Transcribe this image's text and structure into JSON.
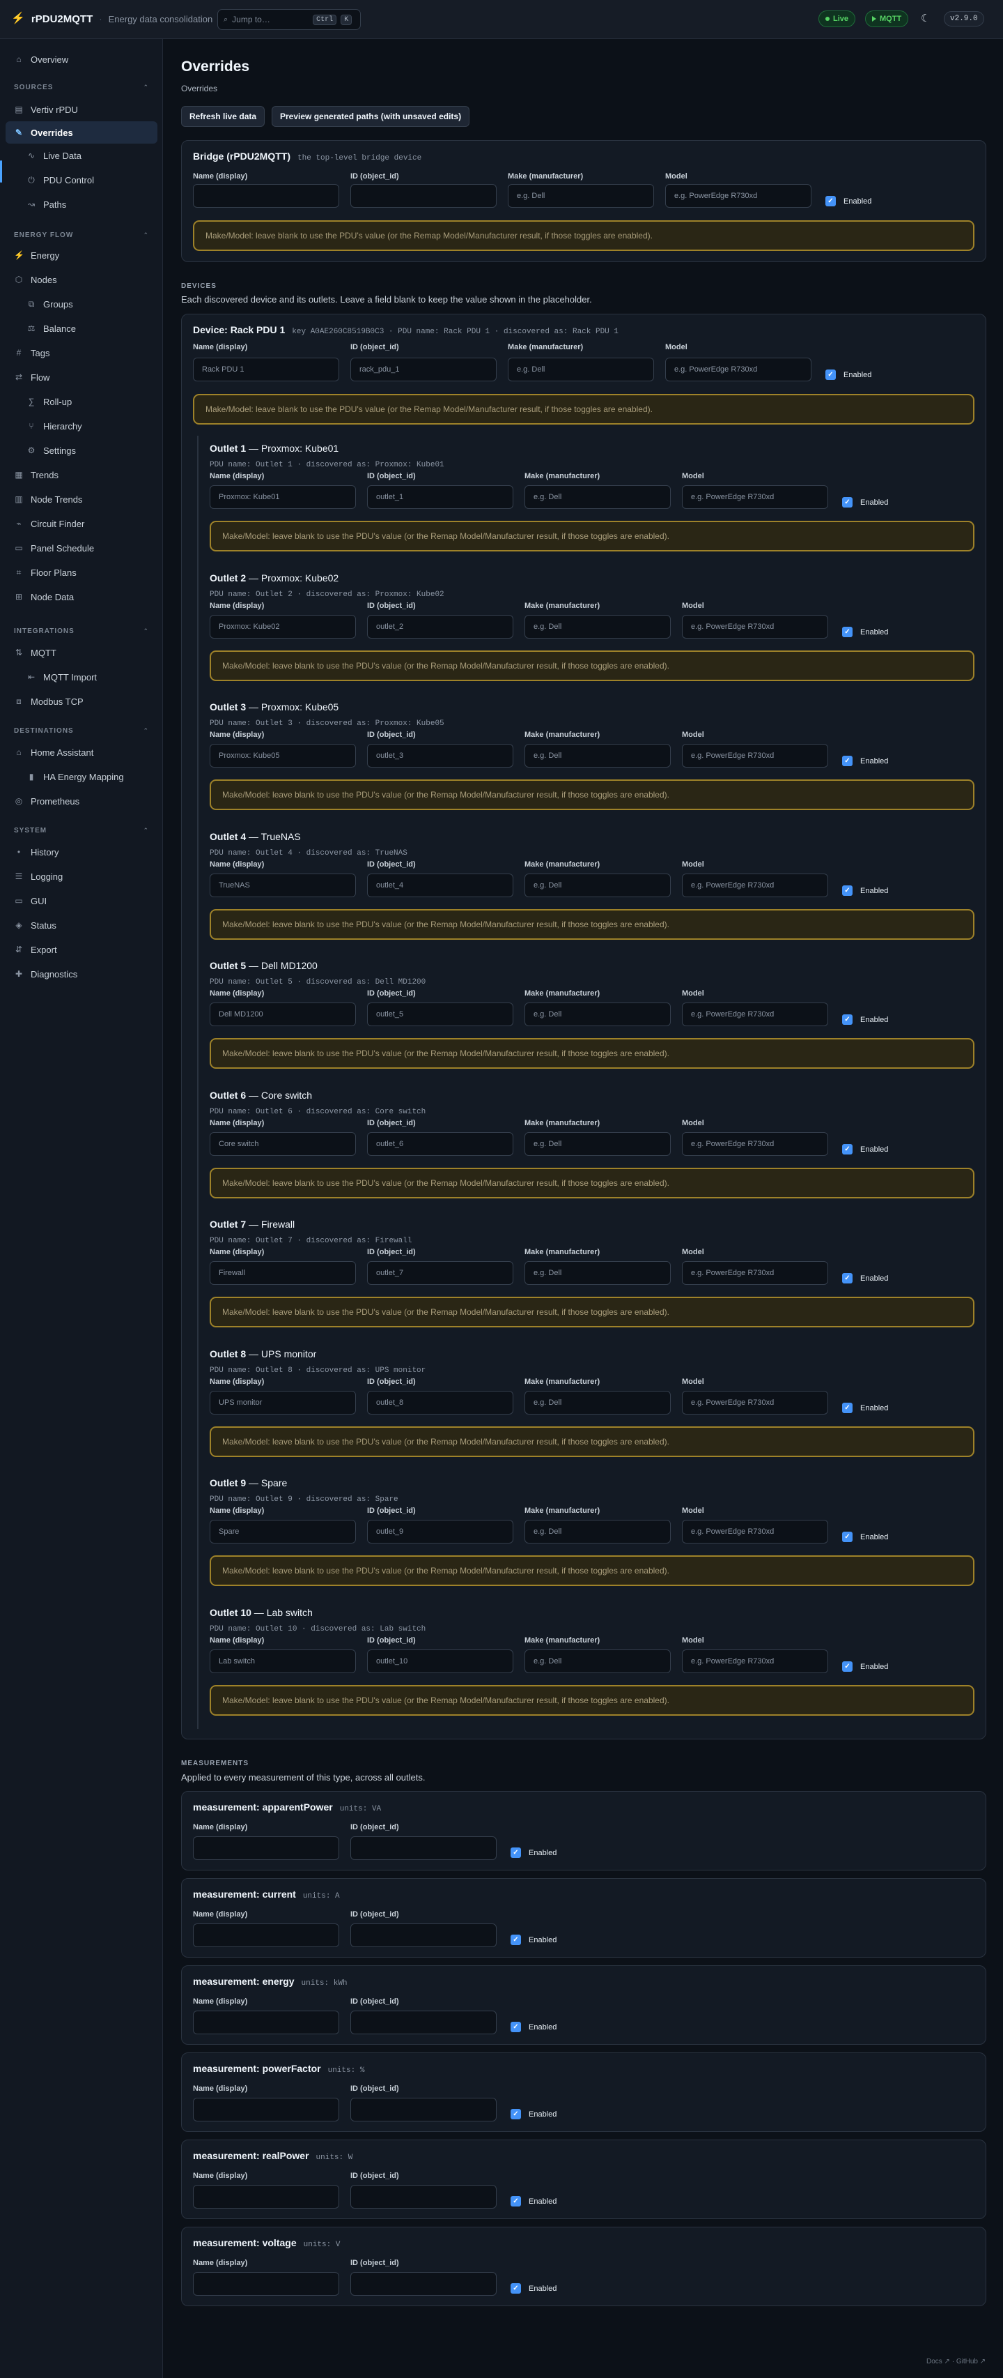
{
  "topbar": {
    "brand": "rPDU2MQTT",
    "subtitle": "Energy data consolidation",
    "search_placeholder": "Jump to…",
    "shortcut_ctrl": "Ctrl",
    "shortcut_k": "K",
    "live_badge": "Live",
    "mqtt_badge": "MQTT",
    "version": "v2.9.0"
  },
  "sidebar": {
    "overview": "Overview",
    "sections": {
      "sources": "SOURCES",
      "energy_flow": "ENERGY FLOW",
      "integrations": "INTEGRATIONS",
      "destinations": "DESTINATIONS",
      "system": "SYSTEM"
    },
    "items": {
      "vertiv": "Vertiv rPDU",
      "overrides": "Overrides",
      "live_data": "Live Data",
      "pdu_control": "PDU Control",
      "paths": "Paths",
      "energy": "Energy",
      "nodes": "Nodes",
      "groups": "Groups",
      "balance": "Balance",
      "tags": "Tags",
      "flow": "Flow",
      "rollup": "Roll-up",
      "hierarchy": "Hierarchy",
      "settings": "Settings",
      "trends": "Trends",
      "node_trends": "Node Trends",
      "circuit_finder": "Circuit Finder",
      "panel_schedule": "Panel Schedule",
      "floor_plans": "Floor Plans",
      "node_data": "Node Data",
      "mqtt": "MQTT",
      "mqtt_import": "MQTT Import",
      "modbus": "Modbus TCP",
      "home_assistant": "Home Assistant",
      "ha_energy": "HA Energy Mapping",
      "prometheus": "Prometheus",
      "history": "History",
      "logging": "Logging",
      "gui": "GUI",
      "status": "Status",
      "export": "Export",
      "diagnostics": "Diagnostics"
    }
  },
  "page": {
    "title": "Overrides",
    "breadcrumb": "Overrides",
    "refresh_button": "Refresh live data",
    "preview_button": "Preview generated paths (with unsaved edits)"
  },
  "fields": {
    "name_label": "Name (display)",
    "id_label": "ID (object_id)",
    "make_label": "Make (manufacturer)",
    "model_label": "Model",
    "make_placeholder": "e.g. Dell",
    "model_placeholder": "e.g. PowerEdge R730xd",
    "enabled_label": "Enabled",
    "hint": "Make/Model: leave blank to use the PDU's value (or the Remap Model/Manufacturer result, if those toggles are enabled)."
  },
  "bridge": {
    "title": "Bridge (rPDU2MQTT)",
    "subtitle": "the top-level bridge device"
  },
  "devices_section": {
    "heading": "DEVICES",
    "description": "Each discovered device and its outlets. Leave a field blank to keep the value shown in the placeholder."
  },
  "device": {
    "title": "Device: Rack PDU 1",
    "meta": "key A0AE260C8519B0C3 · PDU name: Rack PDU 1 · discovered as: Rack PDU 1",
    "name_value": "Rack PDU 1",
    "id_value": "rack_pdu_1"
  },
  "outlets": [
    {
      "num": "Outlet 1",
      "name": "Proxmox: Kube01",
      "meta": "PDU name: Outlet 1 · discovered as: Proxmox: Kube01",
      "id": "outlet_1"
    },
    {
      "num": "Outlet 2",
      "name": "Proxmox: Kube02",
      "meta": "PDU name: Outlet 2 · discovered as: Proxmox: Kube02",
      "id": "outlet_2"
    },
    {
      "num": "Outlet 3",
      "name": "Proxmox: Kube05",
      "meta": "PDU name: Outlet 3 · discovered as: Proxmox: Kube05",
      "id": "outlet_3"
    },
    {
      "num": "Outlet 4",
      "name": "TrueNAS",
      "meta": "PDU name: Outlet 4 · discovered as: TrueNAS",
      "id": "outlet_4"
    },
    {
      "num": "Outlet 5",
      "name": "Dell MD1200",
      "meta": "PDU name: Outlet 5 · discovered as: Dell MD1200",
      "id": "outlet_5"
    },
    {
      "num": "Outlet 6",
      "name": "Core switch",
      "meta": "PDU name: Outlet 6 · discovered as: Core switch",
      "id": "outlet_6"
    },
    {
      "num": "Outlet 7",
      "name": "Firewall",
      "meta": "PDU name: Outlet 7 · discovered as: Firewall",
      "id": "outlet_7"
    },
    {
      "num": "Outlet 8",
      "name": "UPS monitor",
      "meta": "PDU name: Outlet 8 · discovered as: UPS monitor",
      "id": "outlet_8"
    },
    {
      "num": "Outlet 9",
      "name": "Spare",
      "meta": "PDU name: Outlet 9 · discovered as: Spare",
      "id": "outlet_9"
    },
    {
      "num": "Outlet 10",
      "name": "Lab switch",
      "meta": "PDU name: Outlet 10 · discovered as: Lab switch",
      "id": "outlet_10"
    }
  ],
  "measurements_section": {
    "heading": "MEASUREMENTS",
    "description": "Applied to every measurement of this type, across all outlets."
  },
  "measurements": [
    {
      "title": "measurement: apparentPower",
      "units": "units: VA"
    },
    {
      "title": "measurement: current",
      "units": "units: A"
    },
    {
      "title": "measurement: energy",
      "units": "units: kWh"
    },
    {
      "title": "measurement: powerFactor",
      "units": "units: %"
    },
    {
      "title": "measurement: realPower",
      "units": "units: W"
    },
    {
      "title": "measurement: voltage",
      "units": "units: V"
    }
  ],
  "footer": {
    "docs": "Docs ↗",
    "github": "GitHub ↗"
  },
  "colors": {
    "accent": "#4493f8",
    "live": "#56d364",
    "warning_border": "#9e8229",
    "background": "#0c1118"
  }
}
